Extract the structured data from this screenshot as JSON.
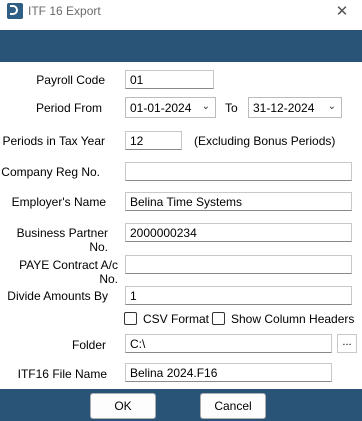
{
  "window": {
    "title": "ITF 16 Export",
    "close_glyph": "✕"
  },
  "form": {
    "payroll_code": {
      "label": "Payroll Code",
      "value": "01"
    },
    "period_from": {
      "label": "Period From",
      "value": "01-01-2024"
    },
    "period_to": {
      "label": "To",
      "value": "31-12-2024"
    },
    "periods_in_tax_year": {
      "label": "Periods in Tax Year",
      "value": "12",
      "note": "(Excluding Bonus Periods)"
    },
    "company_reg_no": {
      "label": "Company Reg No.",
      "value": ""
    },
    "employers_name": {
      "label": "Employer's Name",
      "value": "Belina Time Systems"
    },
    "business_partner_no": {
      "label": "Business Partner No.",
      "value": "2000000234"
    },
    "paye_contract_no": {
      "label": "PAYE Contract A/c No.",
      "value": ""
    },
    "divide_amounts_by": {
      "label": "Divide Amounts By",
      "value": "1"
    },
    "csv_format": {
      "label": "CSV Format",
      "checked": false
    },
    "show_column_headers": {
      "label": "Show Column Headers",
      "checked": false
    },
    "folder": {
      "label": "Folder",
      "value": "C:\\",
      "browse_label": "..."
    },
    "file_name": {
      "label": "ITF16 File Name",
      "value": "Belina 2024.F16"
    }
  },
  "buttons": {
    "ok": "OK",
    "cancel": "Cancel"
  },
  "colors": {
    "banner": "#2a5378"
  }
}
